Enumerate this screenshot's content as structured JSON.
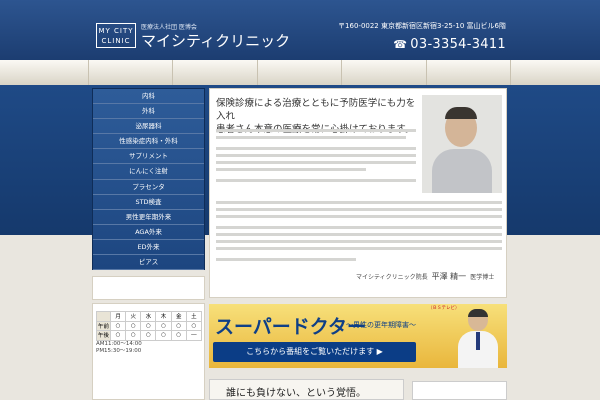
{
  "header": {
    "seo_text": "",
    "logo_line1": "MY CITY",
    "logo_line2": "CLINIC",
    "corp": "医療法人社団 医博会",
    "name": "マイシティクリニック",
    "address": "〒160-0022 東京都新宿区新宿3-25-10 富山ビル6階",
    "access": "",
    "phone": "03-3354-3411"
  },
  "nav": [
    "",
    "",
    "",
    "",
    ""
  ],
  "sidebar": [
    "内科",
    "外科",
    "泌尿器科",
    "性感染症内科・外科",
    "サプリメント",
    "にんにく注射",
    "プラセンタ",
    "STD検査",
    "男性更年期外来",
    "AGA外来",
    "ED外来",
    "ピアス"
  ],
  "main": {
    "lead_line1": "保険診療による治療とともに予防医学にも力を入れ",
    "lead_line2": "患者さん本意の医療を常に心掛けております。",
    "sign_prefix": "マイシティクリニック院長",
    "sign_name": "平澤 精一",
    "sign_title": "医学博士"
  },
  "hours": {
    "heading": "",
    "title": "",
    "row_am": "午前",
    "row_pm": "午後",
    "days": [
      "月",
      "火",
      "水",
      "木",
      "金",
      "土"
    ],
    "am": [
      "○",
      "○",
      "○",
      "○",
      "○",
      "○"
    ],
    "pm": [
      "○",
      "○",
      "○",
      "○",
      "○",
      "―"
    ],
    "note_am": "AM11:00～14:00",
    "note_pm": "PM15:30～19:00",
    "note_red": "",
    "access_head": ""
  },
  "banner": {
    "title": "スーパードクター",
    "subtitle": "～男性の更年期障害～",
    "tv": "（ＢＳテレビ）",
    "button": "こちらから番組をご覧いただけます ▶"
  },
  "bottom": {
    "quote": "誰にも負けない、という覚悟。",
    "right_line1": "",
    "right_line2": ""
  },
  "colors": {
    "brand": "#1f4a86",
    "banner": "#f2c94c",
    "accent_red": "#cc2222"
  },
  "icons": {
    "phone": "phone-icon"
  }
}
